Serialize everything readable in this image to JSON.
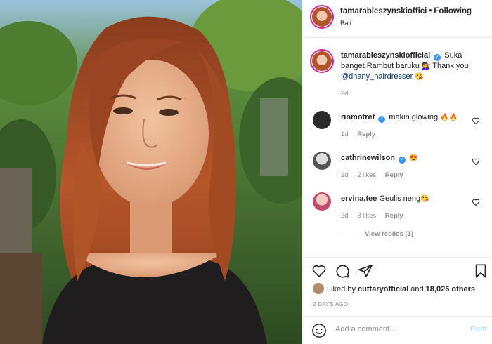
{
  "header": {
    "username": "tamarableszynskiofficial",
    "username_display": "tamarableszynskioffici",
    "dot": "•",
    "follow_status": "Following",
    "location": "Bali"
  },
  "caption": {
    "username": "tamarableszynskiofficial",
    "text_1": "Suka banget Rambut baruku",
    "text_2": "Thank you",
    "mention": "@dhany_hairdresser",
    "emoji_1": "💇‍♀️",
    "emoji_2": "😘",
    "time": "2d"
  },
  "comments": [
    {
      "username": "riomotret",
      "verified": true,
      "text": "makin glowing",
      "emoji": "🔥🔥",
      "time": "1d",
      "likes": "",
      "reply": "Reply"
    },
    {
      "username": "cathrinewilson",
      "verified": true,
      "text": "",
      "emoji": "😍",
      "time": "2d",
      "likes": "2 likes",
      "reply": "Reply"
    },
    {
      "username": "ervina.tee",
      "verified": false,
      "text": "Geulis neng",
      "emoji": "😘",
      "time": "2d",
      "likes": "3 likes",
      "reply": "Reply"
    }
  ],
  "view_replies": "View replies (1)",
  "likes": {
    "prefix": "Liked by",
    "user": "cuttaryofficial",
    "and": "and",
    "count": "18,026 others"
  },
  "date": "2 DAYS AGO",
  "add_comment": {
    "placeholder": "Add a comment...",
    "post_label": "Post"
  },
  "icons": {
    "heart": "heart-icon",
    "comment": "comment-icon",
    "share": "share-icon",
    "save": "bookmark-icon",
    "emoji": "smiley-icon"
  },
  "colors": {
    "verified": "#3897f0",
    "link": "#00376b",
    "muted": "#8e8e8e",
    "post_disabled": "#b2dffc"
  }
}
